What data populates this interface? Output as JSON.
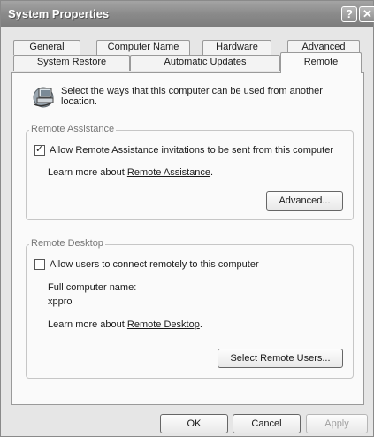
{
  "window": {
    "title": "System Properties",
    "help_glyph": "?",
    "close_glyph": "✕"
  },
  "tabs": {
    "row1": [
      "General",
      "Computer Name",
      "Hardware",
      "Advanced"
    ],
    "row2": [
      "System Restore",
      "Automatic Updates",
      "Remote"
    ],
    "active": "Remote"
  },
  "intro": {
    "icon": "remote-computer-icon",
    "text": "Select the ways that this computer can be used from another location."
  },
  "remote_assistance": {
    "group_label": "Remote Assistance",
    "checkbox_label": "Allow Remote Assistance invitations to be sent from this computer",
    "checked": true,
    "learn_prefix": "Learn more about ",
    "learn_link": "Remote Assistance",
    "learn_suffix": ".",
    "advanced_button": "Advanced..."
  },
  "remote_desktop": {
    "group_label": "Remote Desktop",
    "checkbox_label": "Allow users to connect remotely to this computer",
    "checked": false,
    "computer_name_label": "Full computer name:",
    "computer_name_value": "xppro",
    "learn_prefix": "Learn more about ",
    "learn_link": "Remote Desktop",
    "learn_suffix": ".",
    "select_users_button": "Select Remote Users..."
  },
  "footer": {
    "ok": "OK",
    "cancel": "Cancel",
    "apply": "Apply"
  }
}
